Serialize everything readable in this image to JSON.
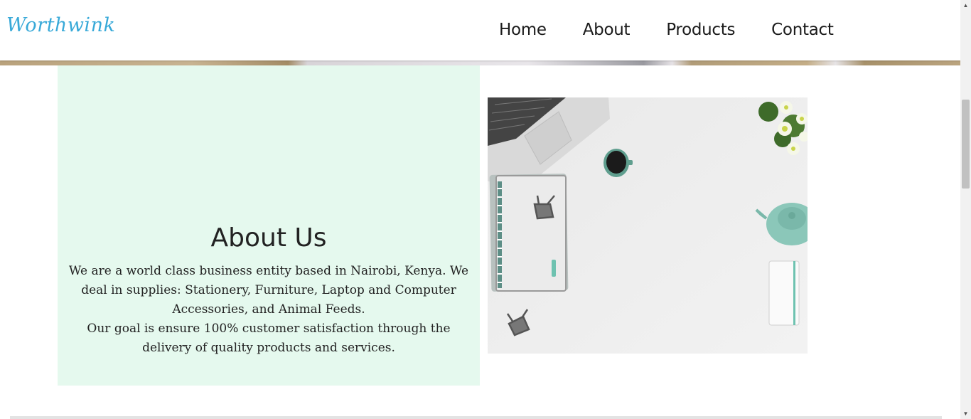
{
  "brand": "Worthwink",
  "nav": {
    "items": [
      "Home",
      "About",
      "Products",
      "Contact"
    ]
  },
  "about": {
    "title": "About Us",
    "paragraph1": "We are a world class business entity based in Nairobi, Kenya. We deal in supplies: Stationery, Furniture, Laptop and Computer Accessories, and Animal Feeds.",
    "paragraph2": "Our goal is ensure 100% customer satisfaction through the delivery of quality products and services."
  },
  "colors": {
    "brand": "#38a9d8",
    "panel": "#e5f9ee",
    "text": "#222222"
  },
  "icons": {
    "scroll_up": "triangle-up",
    "scroll_down": "triangle-down"
  }
}
